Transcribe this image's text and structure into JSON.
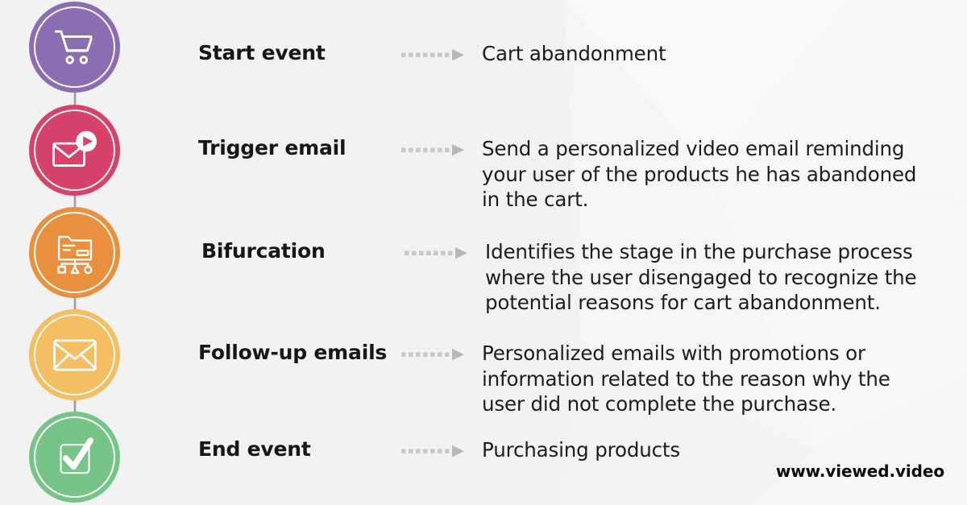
{
  "background": {
    "color": "#f2f2f2",
    "watermark": "faint-geometric-polygons"
  },
  "flow": {
    "connector_color": "#9e9e9e",
    "dotted_arrow_color": "#c4c4c4",
    "steps": [
      {
        "label": "Start event",
        "description": "Cart abandonment",
        "icon": "shopping-cart-icon",
        "color": "#8b6db2"
      },
      {
        "label": "Trigger email",
        "description": "Send a personalized video email reminding your user of the products he has abandoned in the cart.",
        "icon": "email-video-play-icon",
        "color": "#d6426a"
      },
      {
        "label": "Bifurcation",
        "description": "Identifies the stage in the purchase process where the user disengaged to recognize the potential reasons for cart abandonment.",
        "icon": "branching-document-icon",
        "color": "#e8903e"
      },
      {
        "label": "Follow-up emails",
        "description": "Personalized emails with promotions or information related to the reason why the user did not complete the purchase.",
        "icon": "envelope-icon",
        "color": "#f5be63"
      },
      {
        "label": "End event",
        "description": "Purchasing products",
        "icon": "checkbox-check-icon",
        "color": "#77c489"
      }
    ]
  },
  "footer": {
    "website": "www.viewed.video"
  }
}
